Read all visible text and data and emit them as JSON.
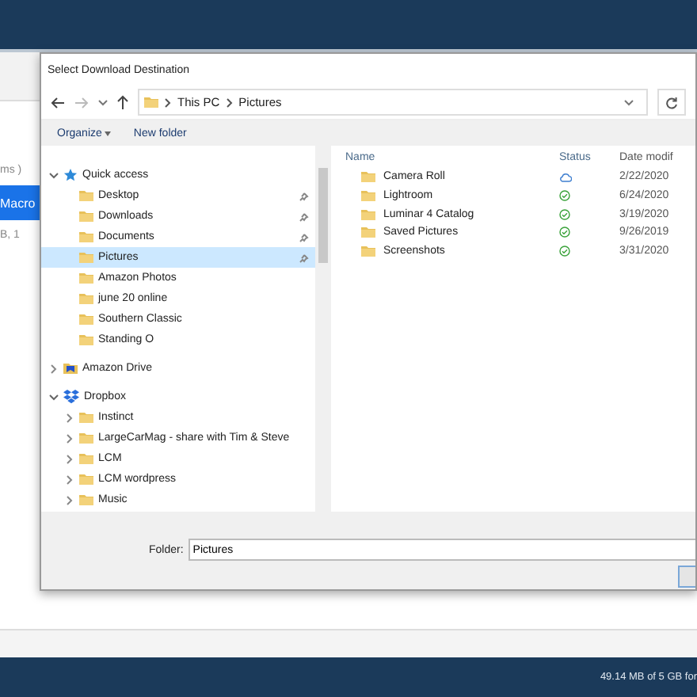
{
  "app": {
    "fragment_1": "ms )",
    "button": "Macro",
    "fragment_2": "B, 1",
    "storage": "49.14 MB of 5 GB for"
  },
  "dialog": {
    "title": "Select Download Destination",
    "breadcrumb": [
      "This PC",
      "Pictures"
    ],
    "toolbar": [
      "Organize",
      "New folder"
    ],
    "tree": [
      {
        "label": "Quick access",
        "kind": "quick",
        "expanded": true,
        "selected": false,
        "children": [
          {
            "label": "Desktop",
            "kind": "folder",
            "pinned": true,
            "selected": false
          },
          {
            "label": "Downloads",
            "kind": "folder",
            "pinned": true,
            "selected": false
          },
          {
            "label": "Documents",
            "kind": "folder",
            "pinned": true,
            "selected": false
          },
          {
            "label": "Pictures",
            "kind": "folder",
            "pinned": true,
            "selected": true
          },
          {
            "label": "Amazon Photos",
            "kind": "folder",
            "pinned": false,
            "selected": false
          },
          {
            "label": "june 20 online",
            "kind": "folder",
            "pinned": false,
            "selected": false
          },
          {
            "label": "Southern Classic",
            "kind": "folder",
            "pinned": false,
            "selected": false
          },
          {
            "label": "Standing O",
            "kind": "folder",
            "pinned": false,
            "selected": false
          }
        ]
      },
      {
        "label": "Amazon Drive",
        "kind": "drive",
        "expanded": false,
        "selected": false
      },
      {
        "label": "Dropbox",
        "kind": "dropbox",
        "expanded": true,
        "selected": false,
        "children": [
          {
            "label": "Instinct",
            "kind": "folder",
            "expanded": false,
            "selected": false
          },
          {
            "label": "LargeCarMag - share with Tim & Steve",
            "kind": "folder",
            "expanded": false,
            "selected": false
          },
          {
            "label": "LCM",
            "kind": "folder",
            "expanded": false,
            "selected": false
          },
          {
            "label": "LCM wordpress",
            "kind": "folder",
            "expanded": false,
            "selected": false
          },
          {
            "label": "Music",
            "kind": "folder",
            "expanded": false,
            "selected": false
          }
        ]
      }
    ],
    "columns": [
      "Name",
      "Status",
      "Date modif"
    ],
    "files": [
      {
        "name": "Camera Roll",
        "synced": false,
        "date": "2/22/2020"
      },
      {
        "name": "Lightroom",
        "synced": true,
        "date": "6/24/2020"
      },
      {
        "name": "Luminar 4 Catalog",
        "synced": true,
        "date": "3/19/2020"
      },
      {
        "name": "Saved Pictures",
        "synced": true,
        "date": "9/26/2019"
      },
      {
        "name": "Screenshots",
        "synced": true,
        "date": "3/31/2020"
      }
    ],
    "folder_label": "Folder:",
    "folder_value": "Pictures"
  }
}
